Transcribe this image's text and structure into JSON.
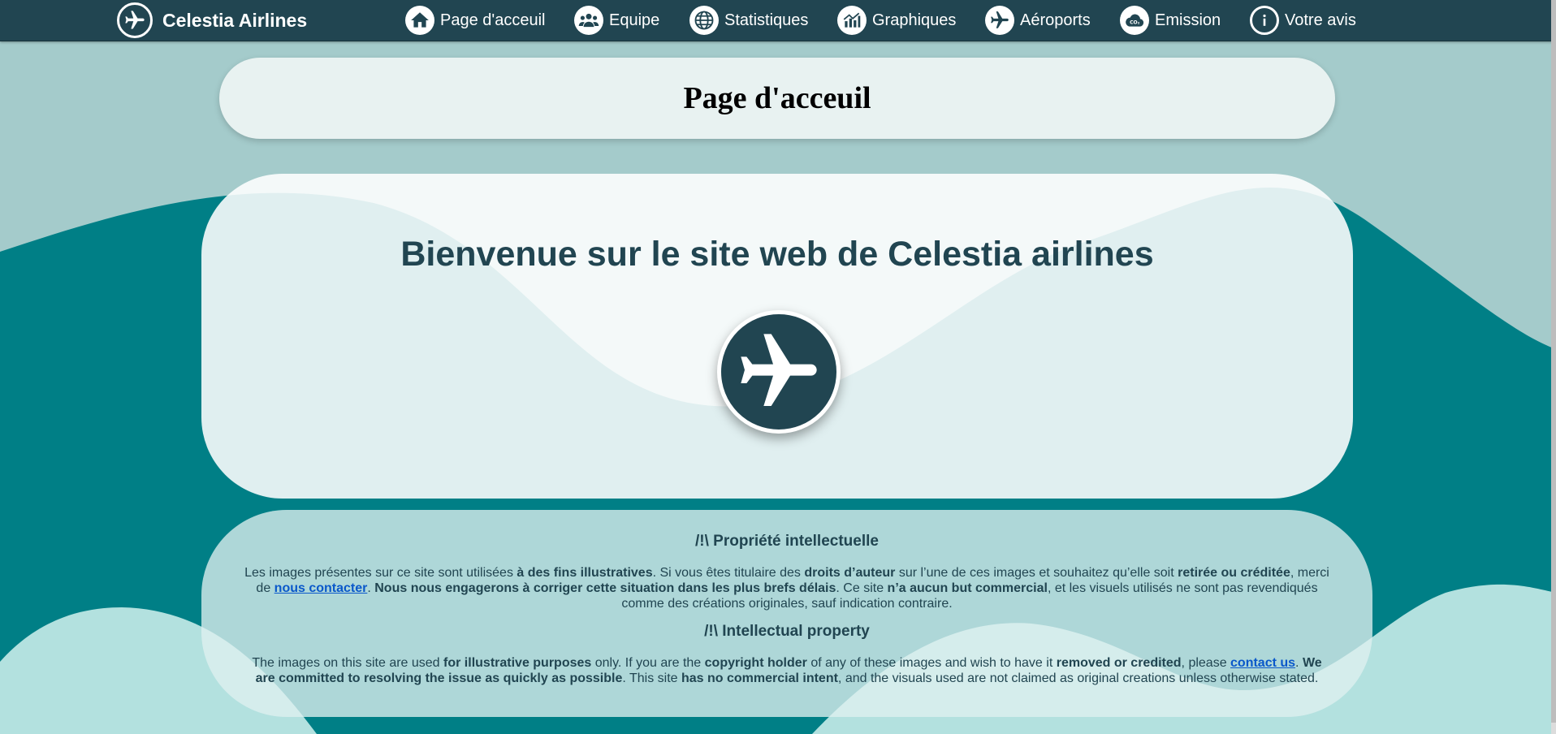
{
  "brand": {
    "name": "Celestia Airlines",
    "icon": "airplane-icon"
  },
  "nav": {
    "items": [
      {
        "label": "Page d'acceuil",
        "icon": "home-icon"
      },
      {
        "label": "Equipe",
        "icon": "team-icon"
      },
      {
        "label": "Statistiques",
        "icon": "globe-stats-icon"
      },
      {
        "label": "Graphiques",
        "icon": "bar-chart-icon"
      },
      {
        "label": "Aéroports",
        "icon": "airplane-icon"
      },
      {
        "label": "Emission",
        "icon": "co2-cloud-icon"
      },
      {
        "label": "Votre avis",
        "icon": "info-icon"
      }
    ]
  },
  "header": {
    "title": "Page d'acceuil"
  },
  "welcome": {
    "title": "Bienvenue sur le site web de Celestia airlines"
  },
  "legal": {
    "fr": {
      "heading": "/!\\ Propriété intellectuelle",
      "t1": "Les images présentes sur ce site sont utilisées ",
      "b1": "à des fins illustratives",
      "t2": ". Si vous êtes titulaire des ",
      "b2": "droits d’auteur",
      "t3": " sur l’une de ces images et souhaitez qu’elle soit ",
      "b3": "retirée ou créditée",
      "t4": ", merci de ",
      "link": "nous contacter",
      "t5": ". ",
      "b4": "Nous nous engagerons à corriger cette situation dans les plus brefs délais",
      "t6": ". Ce site ",
      "b5": "n’a aucun but commercial",
      "t7": ", et les visuels utilisés ne sont pas revendiqués comme des créations originales, sauf indication contraire."
    },
    "en": {
      "heading": "/!\\ Intellectual property",
      "t1": "The images on this site are used ",
      "b1": "for illustrative purposes",
      "t2": " only. If you are the ",
      "b2": "copyright holder",
      "t3": " of any of these images and wish to have it ",
      "b3": "removed or credited",
      "t4": ", please ",
      "link": "contact us",
      "t5": ". ",
      "b4": "We are committed to resolving the issue as quickly as possible",
      "t6": ". This site ",
      "b5": "has no commercial intent",
      "t7": ", and the visuals used are not claimed as original creations unless otherwise stated."
    }
  },
  "colors": {
    "navbar": "#214551",
    "accent_text": "#214551",
    "background_light": "#a4cbcb",
    "background_teal": "#007f86",
    "background_mint": "#b3e1df",
    "link": "#0a58ca"
  }
}
